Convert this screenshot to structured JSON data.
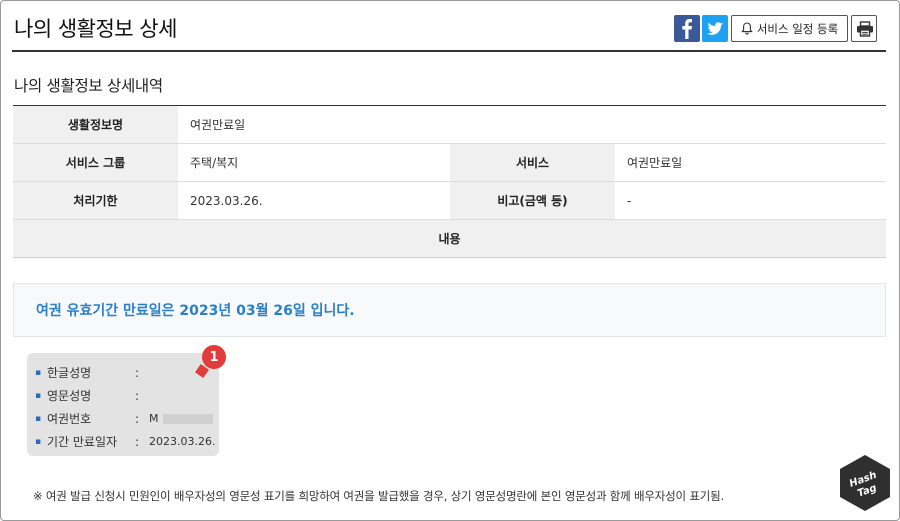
{
  "header": {
    "title": "나의 생활정보 상세",
    "register_label": "서비스 일정 등록"
  },
  "section": {
    "title": "나의 생활정보 상세내역"
  },
  "table": {
    "row1": {
      "label": "생활정보명",
      "value": "여권만료일"
    },
    "row2": {
      "label_a": "서비스 그룹",
      "value_a": "주택/복지",
      "label_b": "서비스",
      "value_b": "여권만료일"
    },
    "row3": {
      "label_a": "처리기한",
      "value_a": "2023.03.26.",
      "label_b": "비고(금액 등)",
      "value_b": "-"
    },
    "content_label": "내용"
  },
  "notice": {
    "text": "여권 유효기간 만료일은 2023년 03월 26일 입니다."
  },
  "info": {
    "items": [
      {
        "label": "한글성명",
        "colon": ":",
        "value": ""
      },
      {
        "label": "영문성명",
        "colon": ":",
        "value": ""
      },
      {
        "label": "여권번호",
        "colon": ":",
        "value": "M"
      },
      {
        "label": "기간 만료일자",
        "colon": ":",
        "value": "2023.03.26."
      }
    ],
    "marker": "1"
  },
  "footnote": {
    "text": "※ 여권 발급 신청시 민원인이 배우자성의 영문성 표기를 희망하여 여권을 발급했을 경우, 상기 영문성명란에 본인 영문성과 함께 배우자성이 표기됨."
  },
  "watermark": {
    "text": "Hash Tag"
  },
  "colors": {
    "facebook": "#3b5998",
    "twitter": "#1da1f2",
    "notice_text": "#2a7fc9",
    "marker": "#e23b3b"
  }
}
